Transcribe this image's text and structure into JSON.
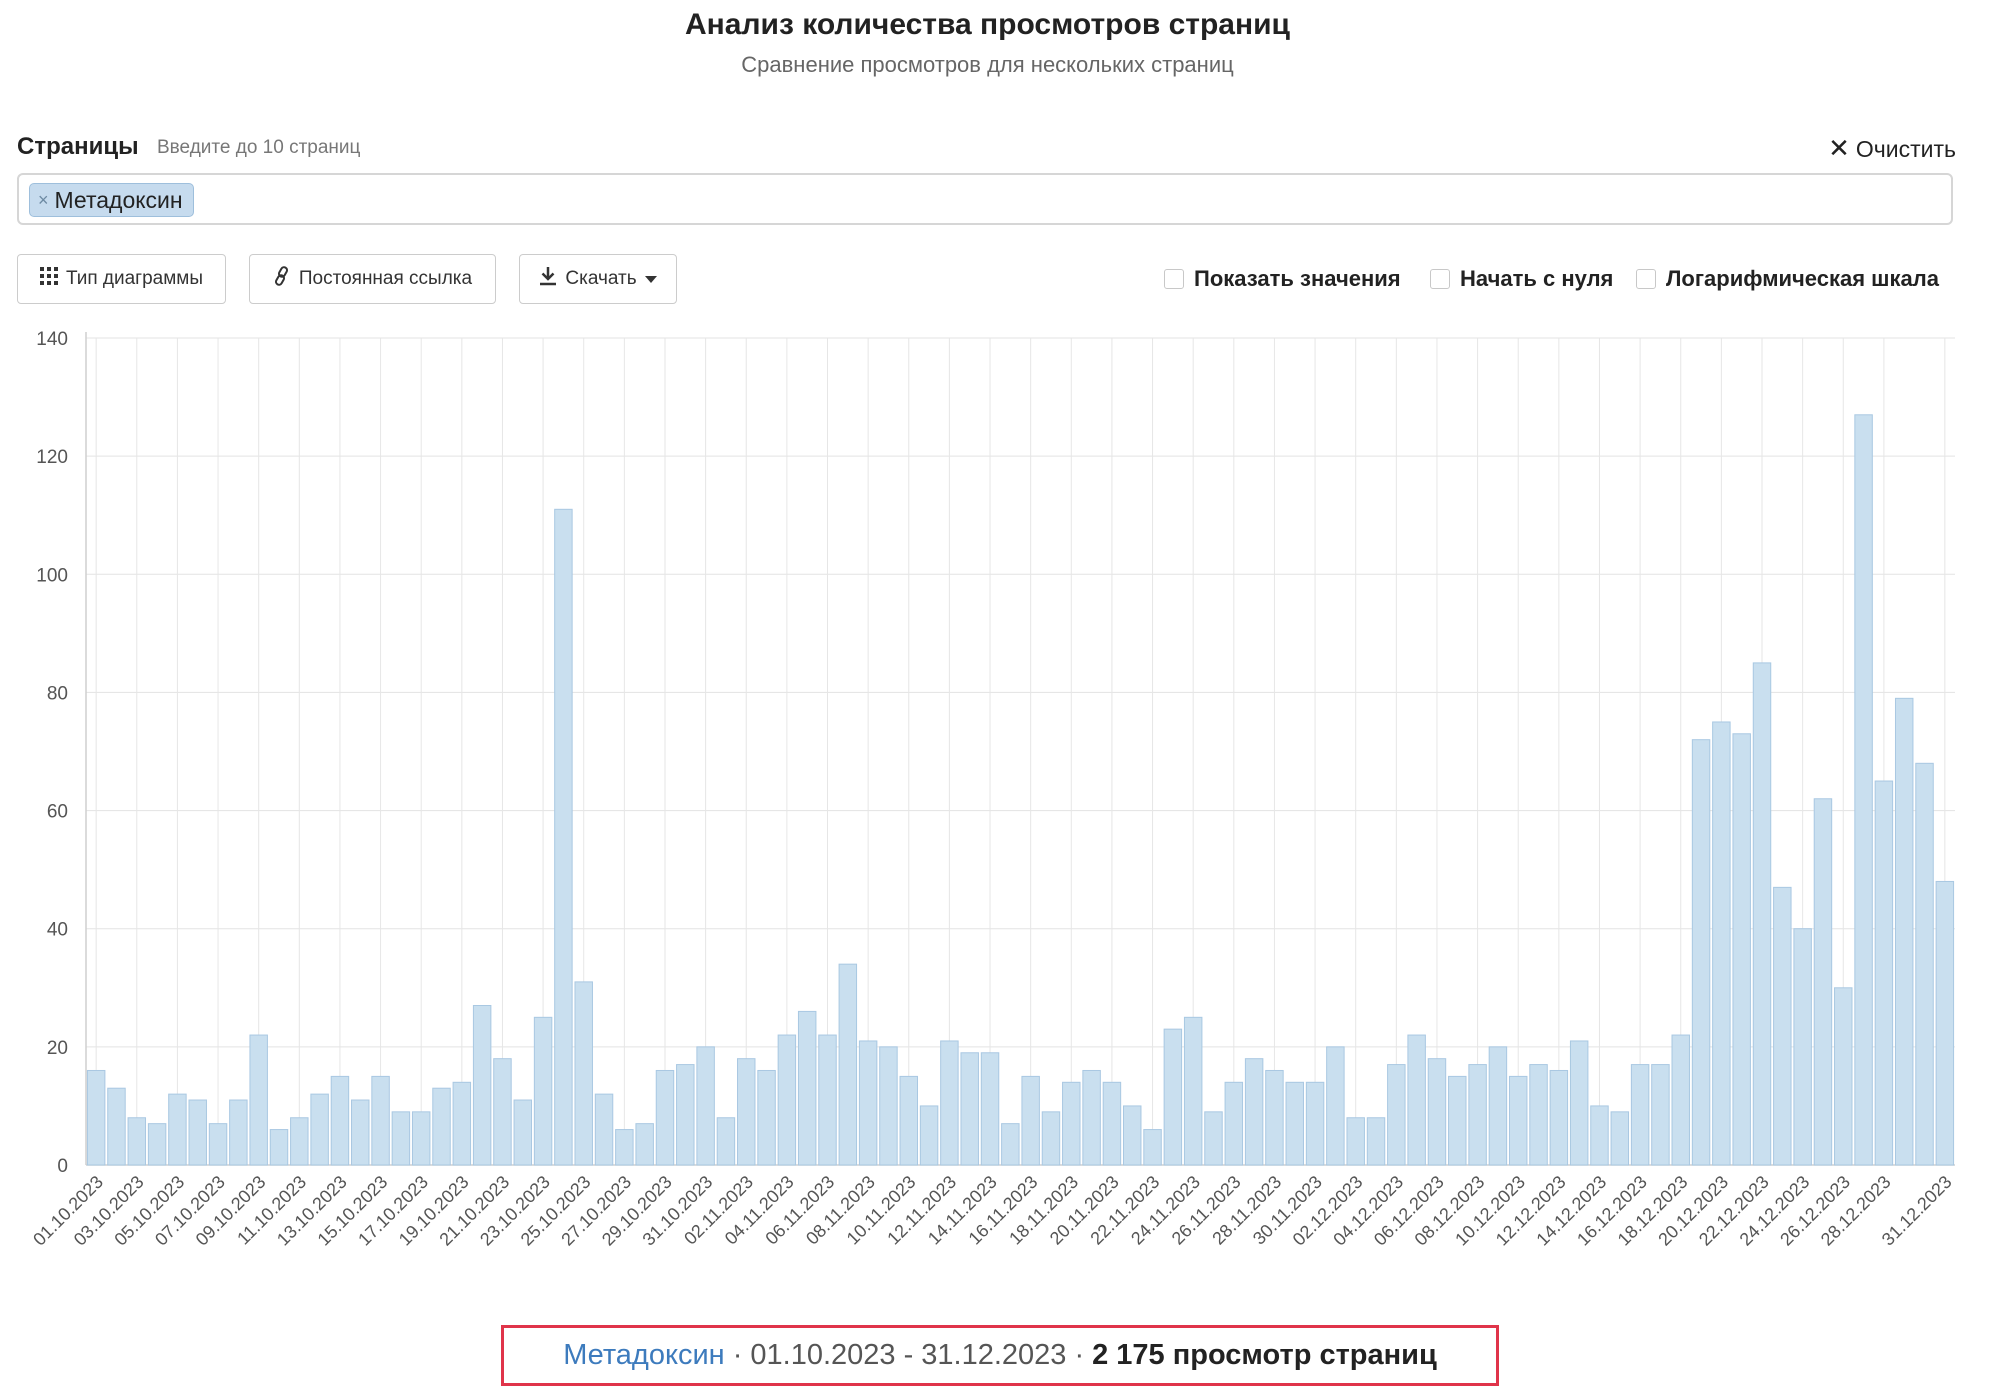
{
  "header": {
    "title": "Анализ количества просмотров страниц",
    "subtitle": "Сравнение просмотров для нескольких страниц"
  },
  "pages_field": {
    "label": "Страницы",
    "hint": "Введите до 10 страниц",
    "clear_label": "Очистить",
    "chips": [
      "Метадоксин"
    ]
  },
  "toolbar": {
    "chart_type_label": "Тип диаграммы",
    "permalink_label": "Постоянная ссылка",
    "download_label": "Скачать"
  },
  "options": {
    "show_values_label": "Показать значения",
    "start_zero_label": "Начать с нуля",
    "log_scale_label": "Логарифмическая шкала"
  },
  "chart_data": {
    "type": "bar",
    "ylim": [
      0,
      140
    ],
    "yticks": [
      0,
      20,
      40,
      60,
      80,
      100,
      120,
      140
    ],
    "grid": true,
    "bar_color": "#c9dfef",
    "bar_border": "#a9c8e2",
    "x_tick_labels": [
      "01.10.2023",
      "03.10.2023",
      "05.10.2023",
      "07.10.2023",
      "09.10.2023",
      "11.10.2023",
      "13.10.2023",
      "15.10.2023",
      "17.10.2023",
      "19.10.2023",
      "21.10.2023",
      "23.10.2023",
      "25.10.2023",
      "27.10.2023",
      "29.10.2023",
      "31.10.2023",
      "02.11.2023",
      "04.11.2023",
      "06.11.2023",
      "08.11.2023",
      "10.11.2023",
      "12.11.2023",
      "14.11.2023",
      "16.11.2023",
      "18.11.2023",
      "20.11.2023",
      "22.11.2023",
      "24.11.2023",
      "26.11.2023",
      "28.11.2023",
      "30.11.2023",
      "02.12.2023",
      "04.12.2023",
      "06.12.2023",
      "08.12.2023",
      "10.12.2023",
      "12.12.2023",
      "14.12.2023",
      "16.12.2023",
      "18.12.2023",
      "20.12.2023",
      "22.12.2023",
      "24.12.2023",
      "26.12.2023",
      "28.12.2023",
      "31.12.2023"
    ],
    "values": [
      16,
      13,
      8,
      7,
      12,
      11,
      7,
      11,
      22,
      6,
      8,
      12,
      15,
      11,
      15,
      9,
      9,
      13,
      14,
      27,
      18,
      11,
      25,
      111,
      31,
      12,
      6,
      7,
      16,
      17,
      20,
      8,
      18,
      16,
      22,
      26,
      22,
      34,
      21,
      20,
      15,
      10,
      21,
      19,
      19,
      7,
      15,
      9,
      14,
      16,
      14,
      10,
      6,
      23,
      25,
      9,
      14,
      18,
      16,
      14,
      14,
      20,
      8,
      8,
      17,
      22,
      18,
      15,
      17,
      20,
      15,
      17,
      16,
      21,
      10,
      9,
      17,
      17,
      22,
      72,
      75,
      73,
      85,
      47,
      40,
      62,
      30,
      127,
      65,
      79,
      68,
      48
    ]
  },
  "footer": {
    "page_name": "Метадоксин",
    "separator": "·",
    "date_range": "01.10.2023 - 31.12.2023",
    "total_text": "2 175 просмотр страниц"
  }
}
